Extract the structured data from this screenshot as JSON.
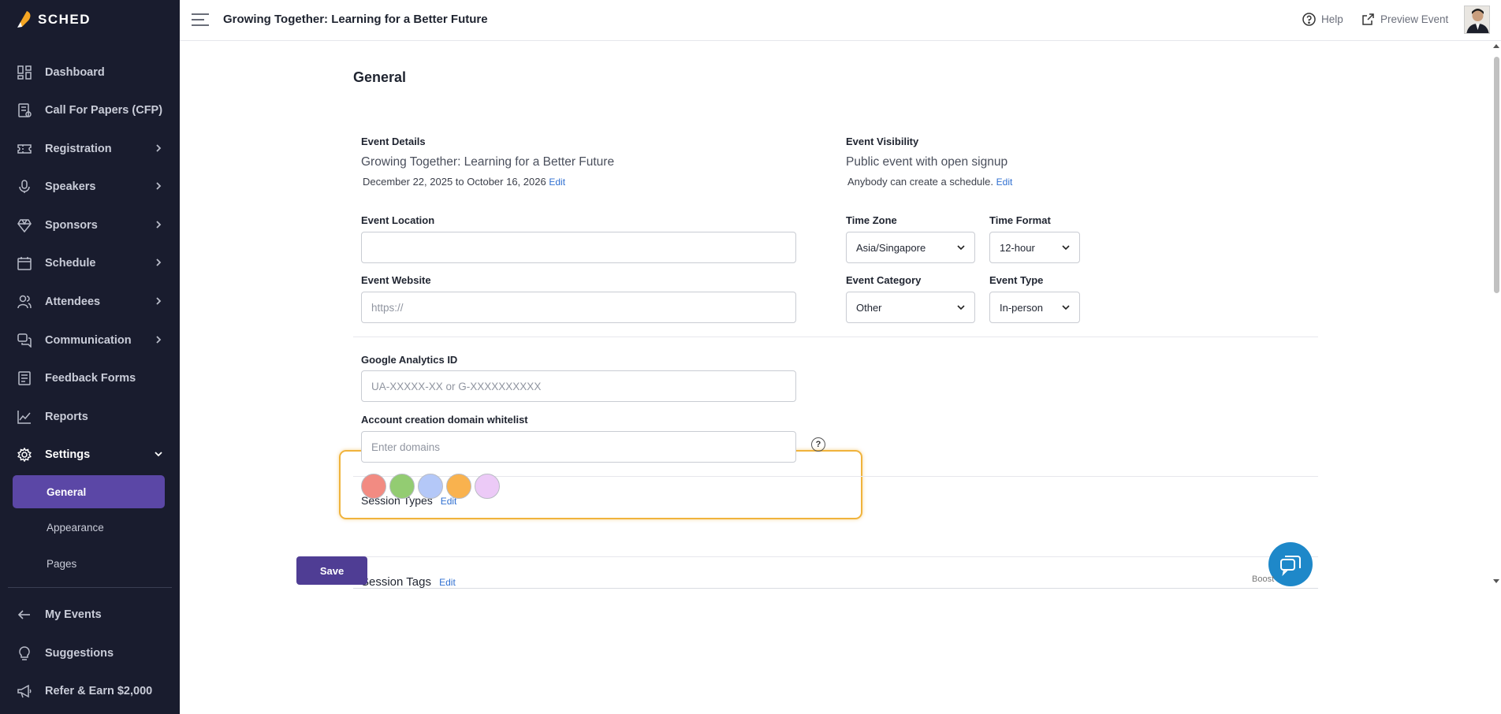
{
  "brand": {
    "name": "SCHED"
  },
  "sidebar": {
    "items": [
      {
        "label": "Dashboard",
        "icon": "dashboard-icon"
      },
      {
        "label": "Call For Papers (CFP)",
        "icon": "cfp-icon"
      },
      {
        "label": "Registration",
        "icon": "ticket-icon"
      },
      {
        "label": "Speakers",
        "icon": "microphone-icon"
      },
      {
        "label": "Sponsors",
        "icon": "diamond-icon"
      },
      {
        "label": "Schedule",
        "icon": "calendar-icon"
      },
      {
        "label": "Attendees",
        "icon": "users-icon"
      },
      {
        "label": "Communication",
        "icon": "chat-icon"
      },
      {
        "label": "Feedback Forms",
        "icon": "form-icon"
      },
      {
        "label": "Reports",
        "icon": "chart-icon"
      },
      {
        "label": "Settings",
        "icon": "gear-icon"
      }
    ],
    "settings_sub": [
      "General",
      "Appearance",
      "Pages"
    ],
    "bottom": [
      {
        "label": "My Events",
        "icon": "arrow-left-icon"
      },
      {
        "label": "Suggestions",
        "icon": "lightbulb-icon"
      },
      {
        "label": "Refer & Earn $2,000",
        "icon": "megaphone-icon"
      }
    ]
  },
  "topbar": {
    "event_title": "Growing Together: Learning for a Better Future",
    "help_label": "Help",
    "preview_label": "Preview Event"
  },
  "main": {
    "title": "General",
    "event_details": {
      "label": "Event Details",
      "name": "Growing Together: Learning for a Better Future",
      "dates": "December 22, 2025 to October 16, 2026",
      "edit": "Edit"
    },
    "event_visibility": {
      "label": "Event Visibility",
      "value": "Public event with open signup",
      "note": "Anybody can create a schedule.",
      "edit": "Edit"
    },
    "event_location": {
      "label": "Event Location",
      "value": "",
      "placeholder": ""
    },
    "time_zone": {
      "label": "Time Zone",
      "value": "Asia/Singapore"
    },
    "time_format": {
      "label": "Time Format",
      "value": "12-hour"
    },
    "event_website": {
      "label": "Event Website",
      "value": "",
      "placeholder": "https://"
    },
    "event_category": {
      "label": "Event Category",
      "value": "Other"
    },
    "event_type": {
      "label": "Event Type",
      "value": "In-person"
    },
    "google_analytics": {
      "label": "Google Analytics ID",
      "value": "",
      "placeholder": "UA-XXXXX-XX or G-XXXXXXXXXX"
    },
    "domain_whitelist": {
      "label": "Account creation domain whitelist",
      "value": "",
      "placeholder": "Enter domains",
      "help": "?"
    },
    "session_types": {
      "label": "Session Types",
      "edit": "Edit",
      "colors": [
        "#f28b82",
        "#93cc72",
        "#b4c8f8",
        "#f9b24e",
        "#eccaf7"
      ]
    },
    "session_tags": {
      "label": "Session Tags",
      "edit": "Edit"
    },
    "save_label": "Save",
    "boost_label": "Boost"
  }
}
